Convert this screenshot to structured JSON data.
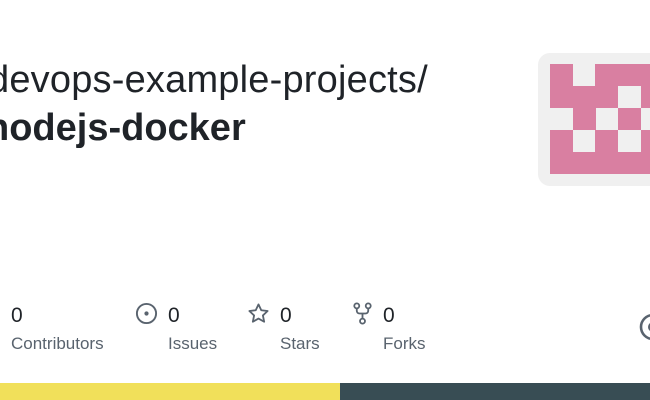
{
  "repo": {
    "owner": "devops-example-projects/",
    "name": "nodejs-docker"
  },
  "stats": [
    {
      "icon": "people-icon",
      "value": "0",
      "label": "Contributors"
    },
    {
      "icon": "issue-icon",
      "value": "0",
      "label": "Issues"
    },
    {
      "icon": "star-icon",
      "value": "0",
      "label": "Stars"
    },
    {
      "icon": "fork-icon",
      "value": "0",
      "label": "Forks"
    }
  ],
  "language_bar": [
    {
      "color": "#f1e05a"
    },
    {
      "color": "#384d54"
    }
  ],
  "colors": {
    "avatar_pink": "#d97fa1",
    "avatar_bg": "#f0f0f0",
    "muted_text": "#59636e"
  }
}
